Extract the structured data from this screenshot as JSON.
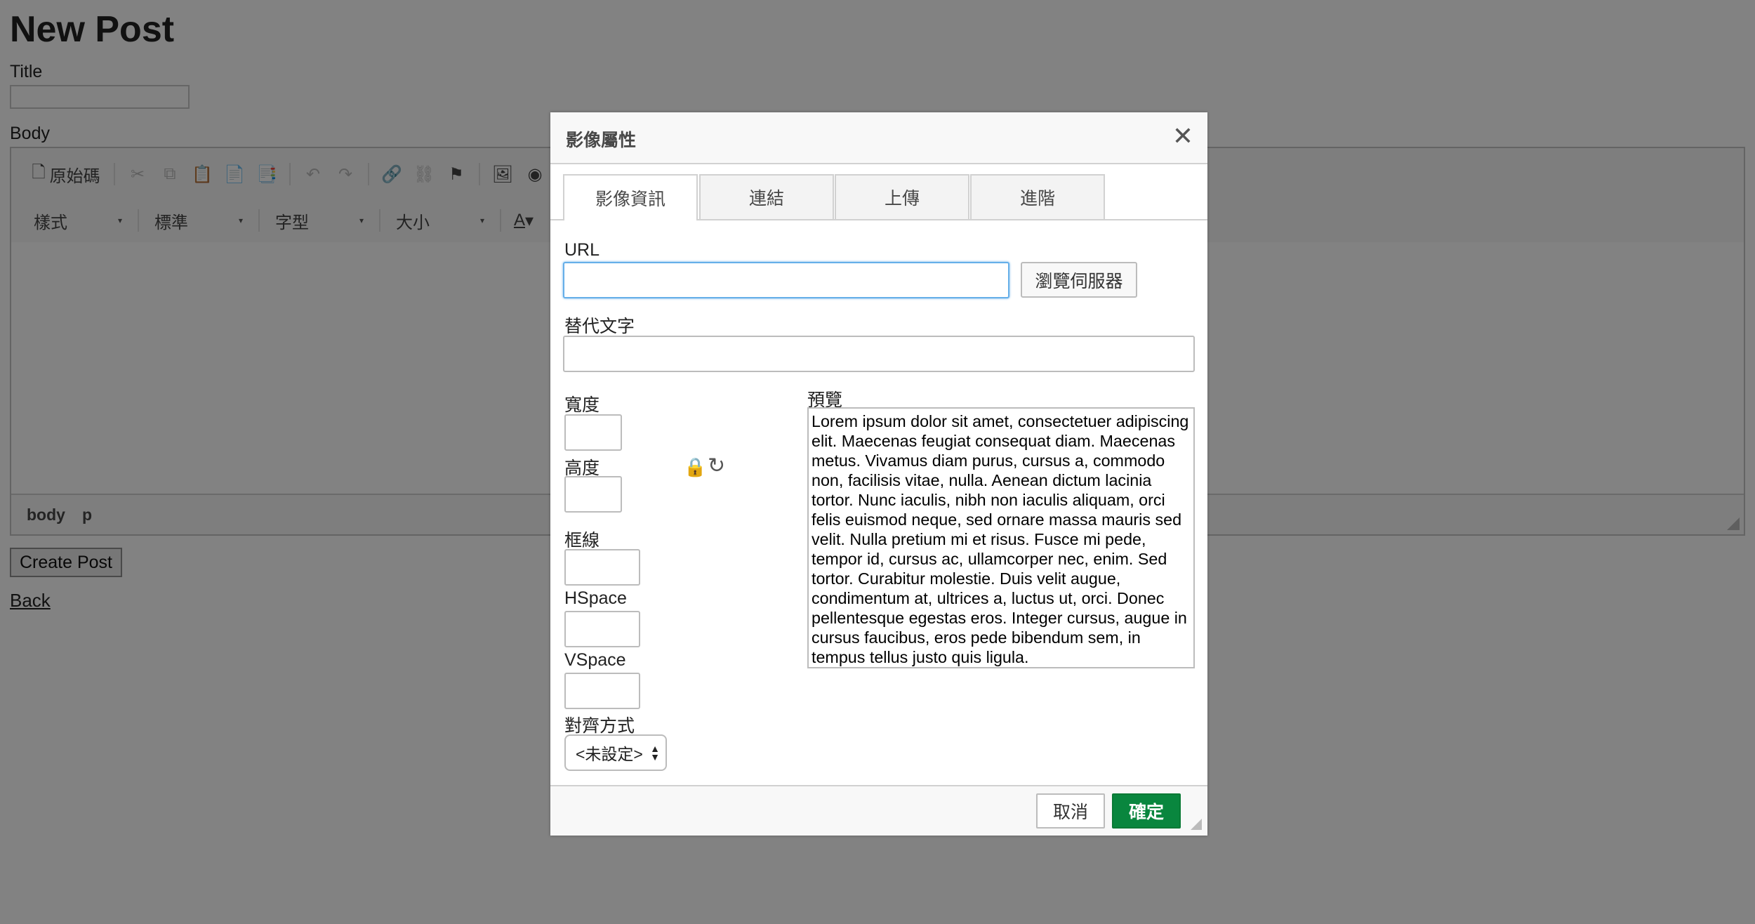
{
  "page": {
    "heading": "New Post",
    "title_label": "Title",
    "body_label": "Body",
    "create_button": "Create Post",
    "back_link": "Back"
  },
  "editor": {
    "toolbar": {
      "source_label": "原始碼",
      "combos": [
        {
          "label": "樣式"
        },
        {
          "label": "標準"
        },
        {
          "label": "字型"
        },
        {
          "label": "大小"
        }
      ]
    },
    "path": [
      "body",
      "p"
    ]
  },
  "dialog": {
    "title": "影像屬性",
    "tabs": [
      "影像資訊",
      "連結",
      "上傳",
      "進階"
    ],
    "active_tab": "影像資訊",
    "url_label": "URL",
    "url_value": "",
    "browse_button": "瀏覽伺服器",
    "alt_label": "替代文字",
    "alt_value": "",
    "width_label": "寬度",
    "height_label": "高度",
    "border_label": "框線",
    "hspace_label": "HSpace",
    "vspace_label": "VSpace",
    "align_label": "對齊方式",
    "align_value": "<未設定>",
    "preview_label": "預覽",
    "preview_text": "Lorem ipsum dolor sit amet, consectetuer adipiscing elit. Maecenas feugiat consequat diam. Maecenas metus. Vivamus diam purus, cursus a, commodo non, facilisis vitae, nulla. Aenean dictum lacinia tortor. Nunc iaculis, nibh non iaculis aliquam, orci felis euismod neque, sed ornare massa mauris sed velit. Nulla pretium mi et risus. Fusce mi pede, tempor id, cursus ac, ullamcorper nec, enim. Sed tortor. Curabitur molestie. Duis velit augue, condimentum at, ultrices a, luctus ut, orci. Donec pellentesque egestas eros. Integer cursus, augue in cursus faucibus, eros pede bibendum sem, in tempus tellus justo quis ligula.",
    "cancel_button": "取消",
    "ok_button": "確定",
    "ok_color": "#09863e"
  }
}
